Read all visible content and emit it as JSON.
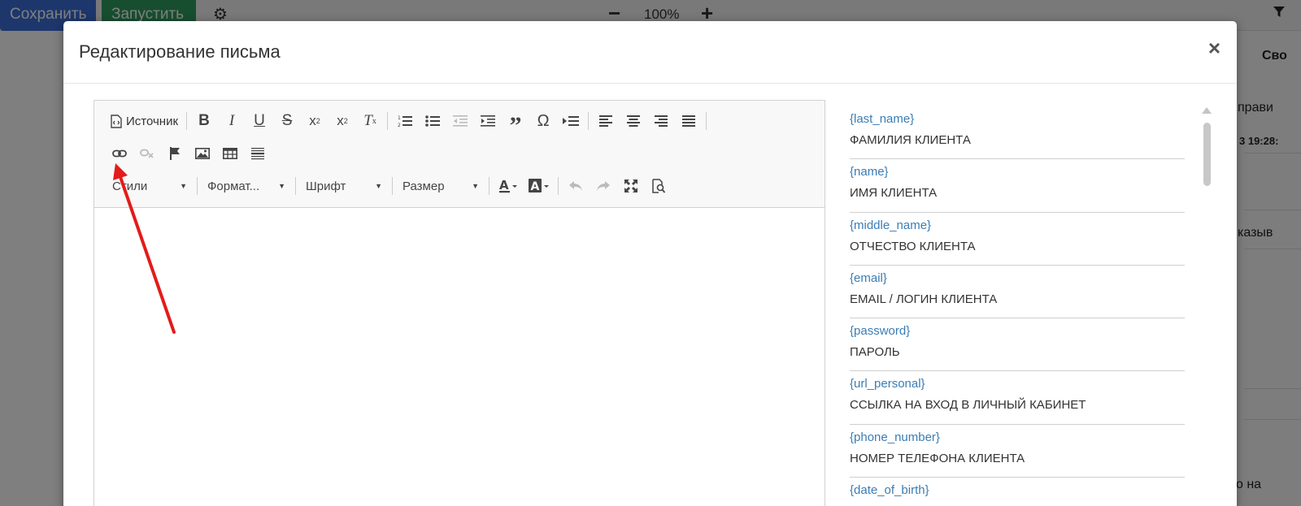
{
  "background": {
    "save_label": "Сохранить",
    "run_label": "Запустить",
    "zoom_minus": "−",
    "zoom_value": "100%",
    "zoom_plus": "+",
    "right_fragments": [
      "Сво",
      "прави",
      "3 19:28:",
      "казыв",
      "о на"
    ]
  },
  "modal": {
    "title": "Редактирование письма",
    "close": "×"
  },
  "toolbar": {
    "source_label": "Источник",
    "styles_label": "Стили",
    "format_label": "Формат...",
    "font_label": "Шрифт",
    "size_label": "Размер"
  },
  "variables": [
    {
      "key": "{last_name}",
      "desc": "ФАМИЛИЯ КЛИЕНТА"
    },
    {
      "key": "{name}",
      "desc": "ИМЯ КЛИЕНТА"
    },
    {
      "key": "{middle_name}",
      "desc": "ОТЧЕСТВО КЛИЕНТА"
    },
    {
      "key": "{email}",
      "desc": "EMAIL / ЛОГИН КЛИЕНТА"
    },
    {
      "key": "{password}",
      "desc": "ПАРОЛЬ"
    },
    {
      "key": "{url_personal}",
      "desc": "ССЫЛКА НА ВХОД В ЛИЧНЫЙ КАБИНЕТ"
    },
    {
      "key": "{phone_number}",
      "desc": "НОМЕР ТЕЛЕФОНА КЛИЕНТА"
    },
    {
      "key": "{date_of_birth}",
      "desc": ""
    }
  ],
  "colors": {
    "save_button": "#3b6fd8",
    "run_button": "#2f9d5f",
    "variable_key": "#3a7db5",
    "annotation_arrow": "#e31b1b"
  }
}
